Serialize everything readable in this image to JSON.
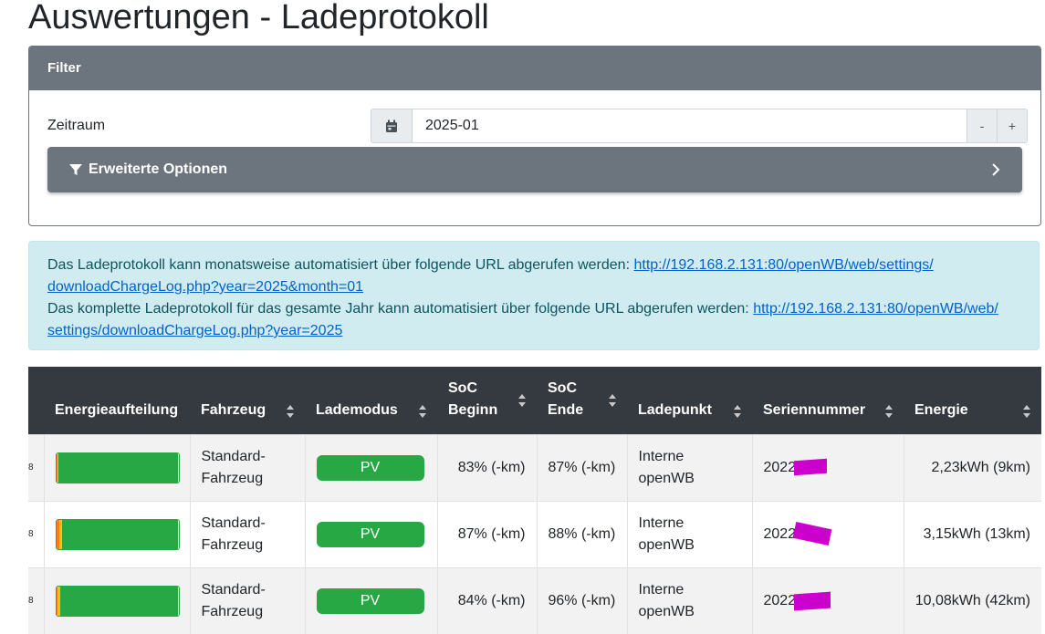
{
  "page": {
    "title": "Auswertungen - Ladeprotokoll"
  },
  "filter": {
    "header": "Filter",
    "zeitraum_label": "Zeitraum",
    "zeitraum_value": "2025-01",
    "minus_label": "-",
    "plus_label": "+",
    "advanced_label": "Erweiterte Optionen"
  },
  "info": {
    "line1_text": "Das Ladeprotokoll kann monatsweise automatisiert über folgende URL abgerufen werden:",
    "line1_url_a": "http://192.168.2.131:80/openWB/web/settings/",
    "line1_url_b": "downloadChargeLog.php?year=2025&month=01",
    "line2_text": "Das komplette Ladeprotokoll für das gesamte Jahr kann automatisiert über folgende URL abgerufen werden:",
    "line2_url_a": "http://192.168.2.131:80/openWB/web/",
    "line2_url_b": "settings/downloadChargeLog.php?year=2025"
  },
  "table": {
    "columns": [
      {
        "l1": "Energieaufteilung",
        "l2": ""
      },
      {
        "l1": "Fahrzeug",
        "l2": ""
      },
      {
        "l1": "Lademodus",
        "l2": ""
      },
      {
        "l1": "SoC",
        "l2": "Beginn"
      },
      {
        "l1": "SoC",
        "l2": "Ende"
      },
      {
        "l1": "Ladepunkt",
        "l2": ""
      },
      {
        "l1": "Seriennummer",
        "l2": ""
      },
      {
        "l1": "Energie",
        "l2": ""
      }
    ],
    "rows": [
      {
        "lead": "8",
        "fz1": "Standard-",
        "fz2": "Fahrzeug",
        "modus": "PV",
        "soc_start": "83% (-km)",
        "soc_end": "87% (-km)",
        "lp1": "Interne",
        "lp2": "openWB",
        "serial": "2022",
        "energie": "2,23kWh (9km)",
        "split": [
          0.01,
          0.01,
          0.98
        ]
      },
      {
        "lead": "8",
        "fz1": "Standard-",
        "fz2": "Fahrzeug",
        "modus": "PV",
        "soc_start": "87% (-km)",
        "soc_end": "88% (-km)",
        "lp1": "Interne",
        "lp2": "openWB",
        "serial": "2022",
        "energie": "3,15kWh (13km)",
        "split": [
          0.025,
          0.025,
          0.95
        ]
      },
      {
        "lead": "8",
        "fz1": "Standard-",
        "fz2": "Fahrzeug",
        "modus": "PV",
        "soc_start": "84% (-km)",
        "soc_end": "96% (-km)",
        "lp1": "Interne",
        "lp2": "openWB",
        "serial": "2022",
        "energie": "10,08kWh (42km)",
        "split": [
          0.01,
          0.02,
          0.97
        ]
      }
    ]
  },
  "colors": {
    "grid": "#fd7e14",
    "battery": "#ffc107",
    "pv": "#28a745",
    "redaction": "#cc00cc"
  }
}
